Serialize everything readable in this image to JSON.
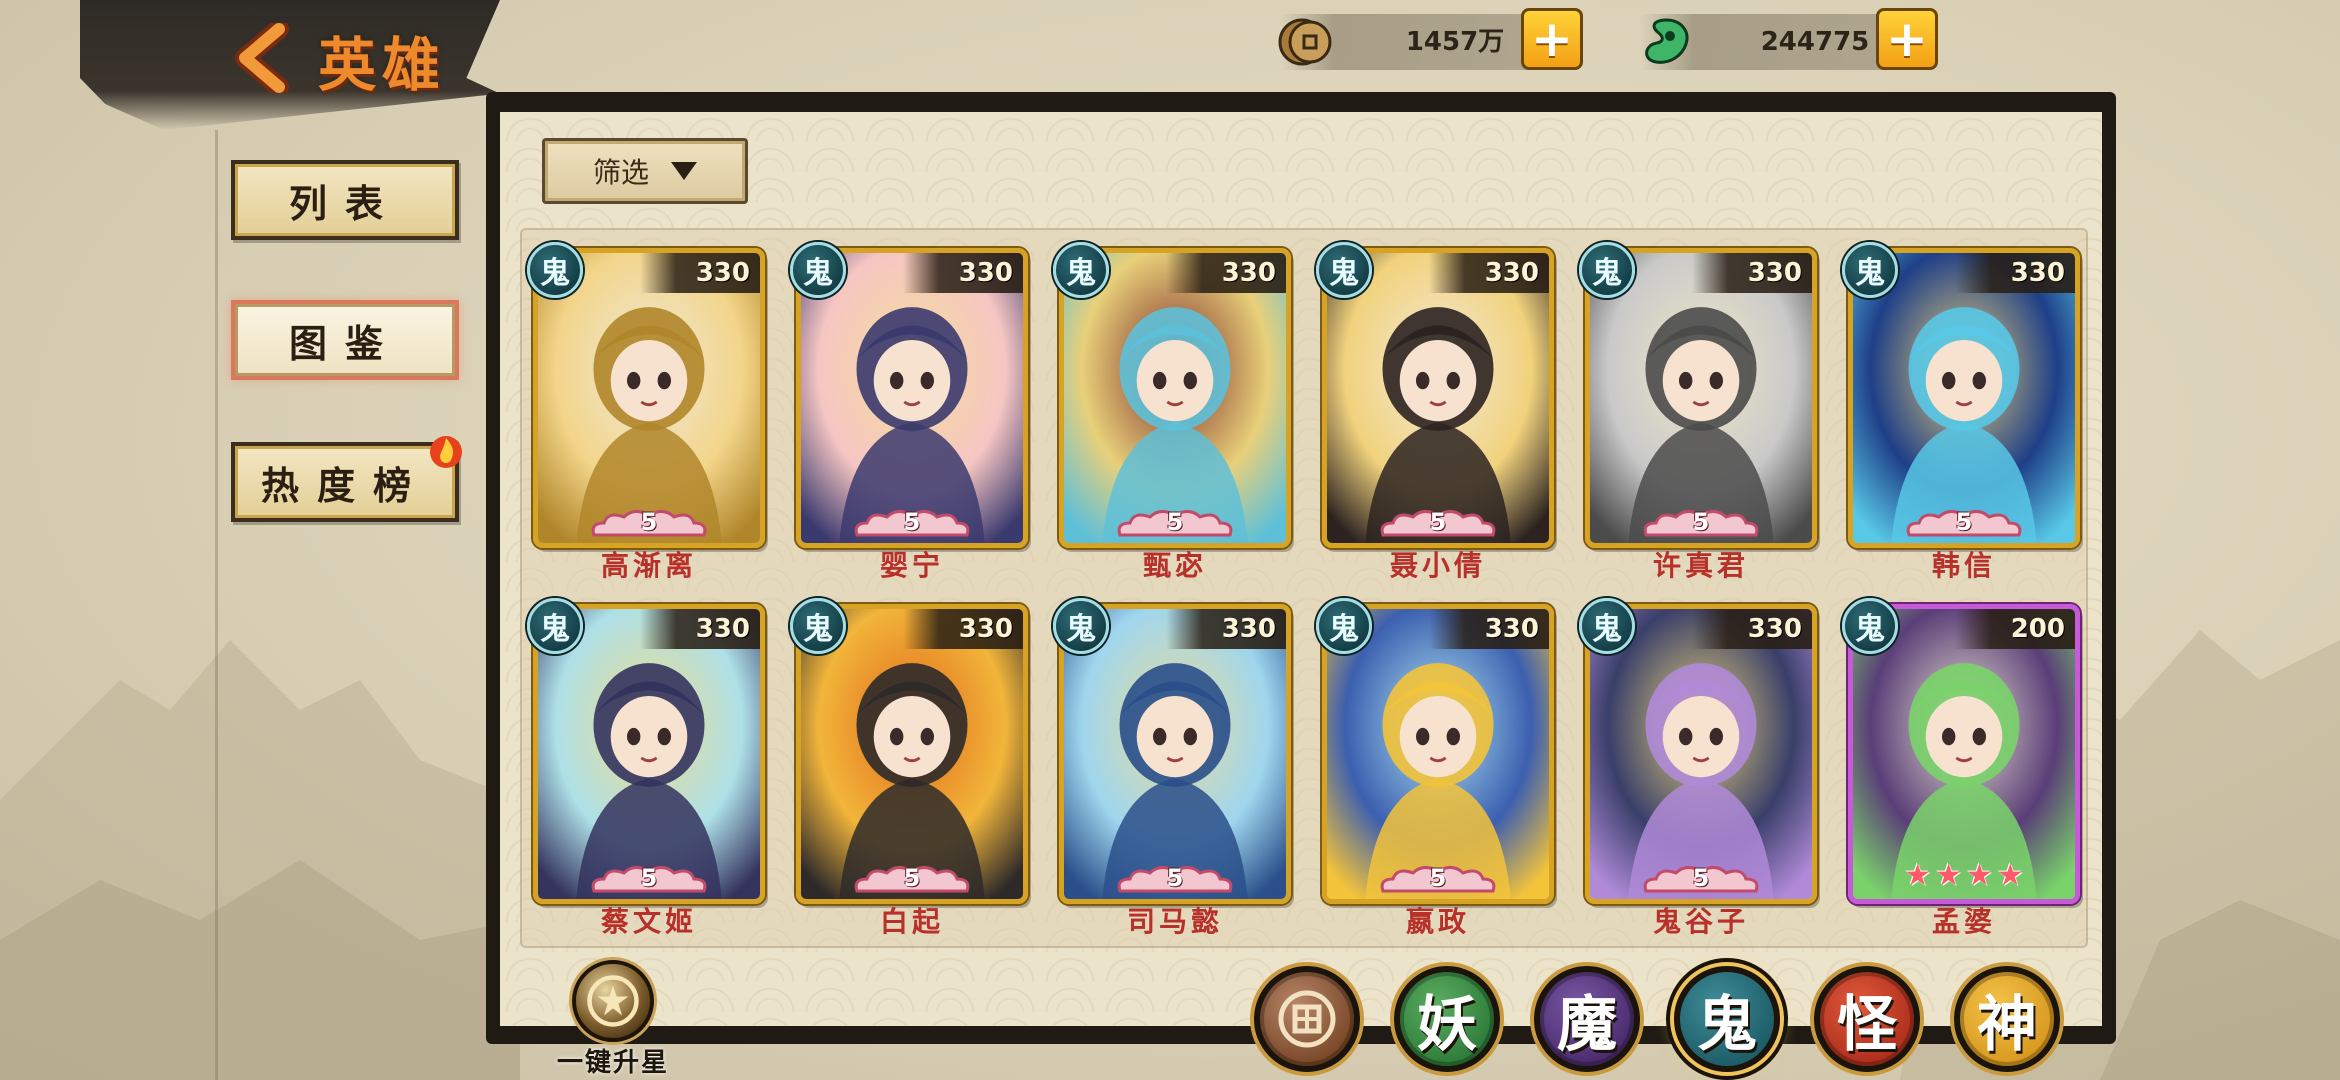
{
  "header": {
    "title": "英雄",
    "back_icon": "chevron-left-icon"
  },
  "sidebar": {
    "items": [
      {
        "label": "列表",
        "active": false
      },
      {
        "label": "图鉴",
        "active": true
      },
      {
        "label": "热度榜",
        "active": false,
        "badge": "fire-icon"
      }
    ]
  },
  "currency": {
    "coins": {
      "value": "1457万",
      "icon": "coin-icon"
    },
    "jade": {
      "value": "244775",
      "icon": "jade-icon"
    }
  },
  "filter": {
    "label": "筛选"
  },
  "heroes": [
    {
      "name": "高渐离",
      "faction": "鬼",
      "power": "330",
      "stars": "5",
      "frame": "gold",
      "palette": [
        "#f3d58a",
        "#b0862a",
        "#efe8d8"
      ]
    },
    {
      "name": "婴宁",
      "faction": "鬼",
      "power": "330",
      "stars": "5",
      "frame": "gold",
      "palette": [
        "#f6c6c3",
        "#3b3a6e",
        "#f4dd9a"
      ]
    },
    {
      "name": "甄宓",
      "faction": "鬼",
      "power": "330",
      "stars": "5",
      "frame": "gold",
      "palette": [
        "#e8d07a",
        "#5ec0d8",
        "#7a2a2a"
      ]
    },
    {
      "name": "聂小倩",
      "faction": "鬼",
      "power": "330",
      "stars": "5",
      "frame": "gold",
      "palette": [
        "#f1d27d",
        "#2c2321",
        "#f3ead8"
      ]
    },
    {
      "name": "许真君",
      "faction": "鬼",
      "power": "330",
      "stars": "5",
      "frame": "gold",
      "palette": [
        "#c9c9c9",
        "#4b4b4b",
        "#efe8c8"
      ]
    },
    {
      "name": "韩信",
      "faction": "鬼",
      "power": "330",
      "stars": "5",
      "frame": "gold",
      "palette": [
        "#1f3f88",
        "#58c8e6",
        "#e8d27a"
      ]
    },
    {
      "name": "蔡文姬",
      "faction": "鬼",
      "power": "330",
      "stars": "5",
      "frame": "gold",
      "palette": [
        "#aee0e8",
        "#34335e",
        "#eedb8c"
      ]
    },
    {
      "name": "白起",
      "faction": "鬼",
      "power": "330",
      "stars": "5",
      "frame": "gold",
      "palette": [
        "#f2b53a",
        "#2e2a2a",
        "#e06a1a"
      ]
    },
    {
      "name": "司马懿",
      "faction": "鬼",
      "power": "330",
      "stars": "5",
      "frame": "gold",
      "palette": [
        "#9fd6ee",
        "#2a4f8a",
        "#eadb9a"
      ]
    },
    {
      "name": "嬴政",
      "faction": "鬼",
      "power": "330",
      "stars": "5",
      "frame": "gold",
      "palette": [
        "#3c5fb0",
        "#f3c33a",
        "#aee6f2"
      ]
    },
    {
      "name": "鬼谷子",
      "faction": "鬼",
      "power": "330",
      "stars": "5",
      "frame": "gold",
      "palette": [
        "#3a3f6a",
        "#b08ad8",
        "#e8d27a"
      ]
    },
    {
      "name": "孟婆",
      "faction": "鬼",
      "power": "200",
      "stars": "4",
      "frame": "purple",
      "palette": [
        "#5a3e78",
        "#7ad36a",
        "#e8e0d0"
      ]
    }
  ],
  "bottom": {
    "upstar_label": "一键升星"
  },
  "factions": [
    {
      "label": "",
      "icon": "all-factions-icon",
      "color": "#7b4a2a",
      "active": false
    },
    {
      "label": "妖",
      "color": "#2f7d3a",
      "active": false
    },
    {
      "label": "魔",
      "color": "#4b2d6e",
      "active": false
    },
    {
      "label": "鬼",
      "color": "#1f5f6a",
      "active": true
    },
    {
      "label": "怪",
      "color": "#b0301e",
      "active": false
    },
    {
      "label": "神",
      "color": "#d99a20",
      "active": false
    }
  ]
}
